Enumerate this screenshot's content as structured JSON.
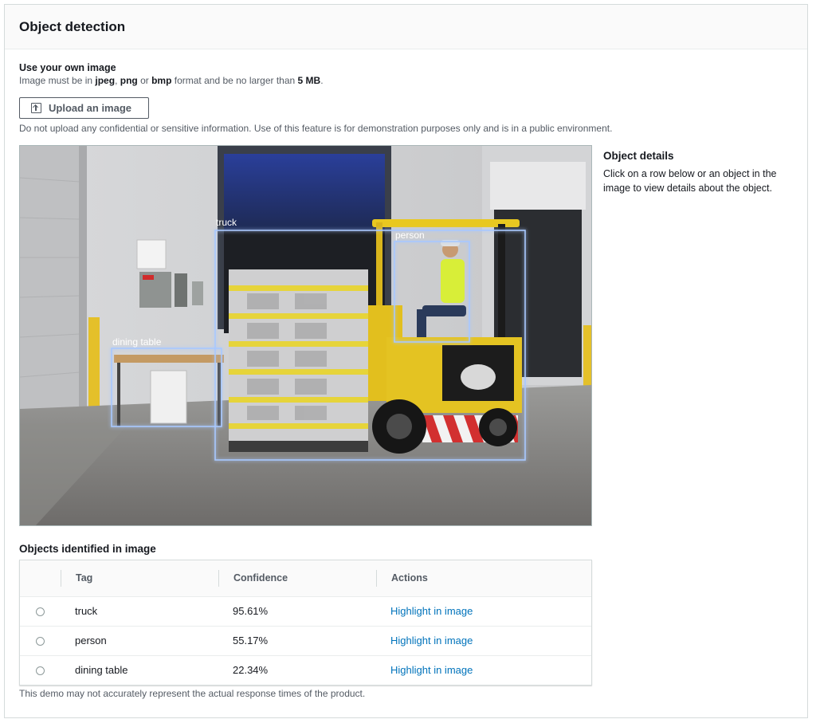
{
  "panel": {
    "title": "Object detection"
  },
  "upload": {
    "title": "Use your own image",
    "format_prefix": "Image must be in ",
    "fmt_jpeg": "jpeg",
    "sep1": ", ",
    "fmt_png": "png",
    "sep2": " or ",
    "fmt_bmp": "bmp",
    "size_text": " format and be no larger than ",
    "size_limit": "5 MB",
    "period": ".",
    "button_label": "Upload an image",
    "button_icon": "upload-icon",
    "disclaimer": "Do not upload any confidential or sensitive information. Use of this feature is for demonstration purposes only and is in a public environment."
  },
  "image": {
    "labels": {
      "truck": "truck",
      "person": "person",
      "dining_table": "dining table"
    },
    "box_color": "#8fb8ff"
  },
  "details": {
    "title": "Object details",
    "text": "Click on a row below or an object in the image to view details about the object."
  },
  "objects": {
    "title": "Objects identified in image",
    "columns": [
      "Tag",
      "Confidence",
      "Actions"
    ],
    "rows": [
      {
        "tag": "truck",
        "confidence": "95.61%",
        "action": "Highlight in image"
      },
      {
        "tag": "person",
        "confidence": "55.17%",
        "action": "Highlight in image"
      },
      {
        "tag": "dining table",
        "confidence": "22.34%",
        "action": "Highlight in image"
      }
    ]
  },
  "footnote": "This demo may not accurately represent the actual response times of the product.",
  "colors": {
    "link": "#0073bb",
    "text": "#16191f",
    "muted": "#545b64"
  }
}
